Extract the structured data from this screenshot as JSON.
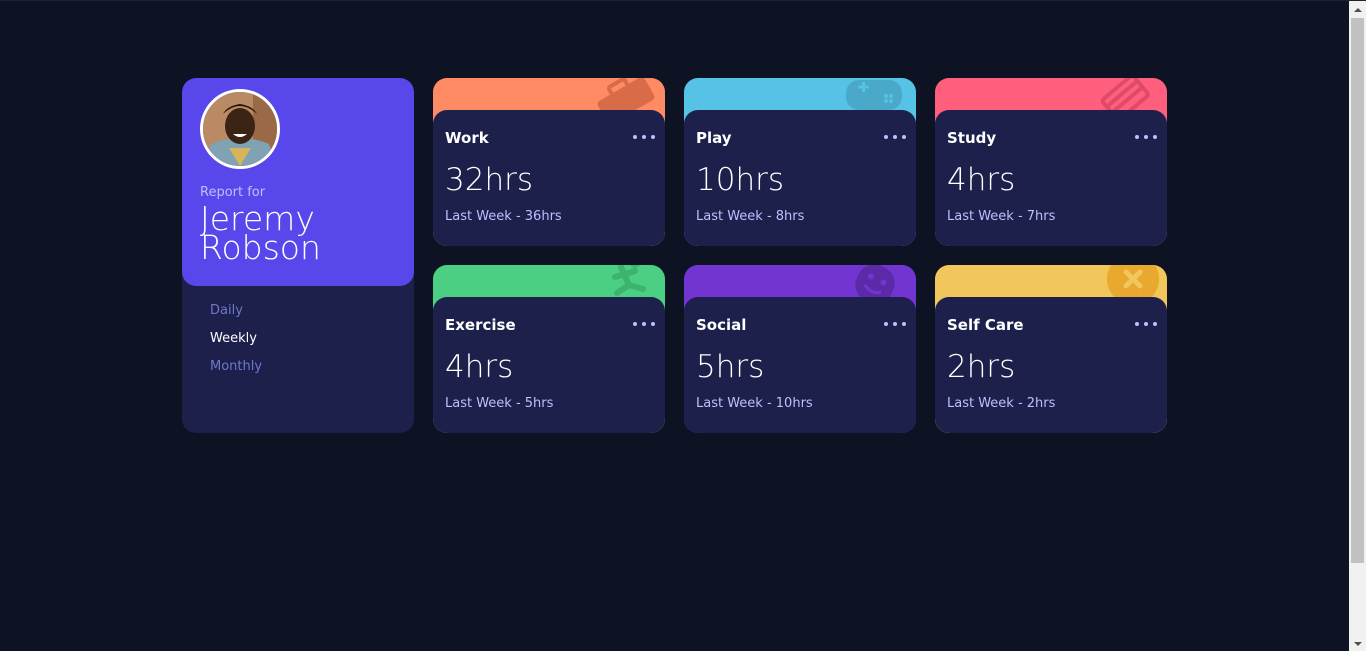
{
  "profile": {
    "report_for": "Report for",
    "name": "Jeremy Robson",
    "periods": [
      "Daily",
      "Weekly",
      "Monthly"
    ],
    "active_period": "Weekly"
  },
  "cards": [
    {
      "title": "Work",
      "current": "32hrs",
      "previous": "Last Week - 36hrs",
      "color": "#ff8b64",
      "icon": "briefcase-icon"
    },
    {
      "title": "Play",
      "current": "10hrs",
      "previous": "Last Week - 8hrs",
      "color": "#55c2e6",
      "icon": "gamepad-icon"
    },
    {
      "title": "Study",
      "current": "4hrs",
      "previous": "Last Week - 7hrs",
      "color": "#ff5e7d",
      "icon": "book-icon"
    },
    {
      "title": "Exercise",
      "current": "4hrs",
      "previous": "Last Week - 5hrs",
      "color": "#4bcf82",
      "icon": "running-icon"
    },
    {
      "title": "Social",
      "current": "5hrs",
      "previous": "Last Week - 10hrs",
      "color": "#7335d2",
      "icon": "social-icon"
    },
    {
      "title": "Self Care",
      "current": "2hrs",
      "previous": "Last Week - 2hrs",
      "color": "#f1c75b",
      "icon": "self-care-icon"
    }
  ],
  "colors": {
    "background": "#0e1323",
    "card": "#1c204b",
    "profile_accent": "#5847eb",
    "muted_text": "#bbc0ff",
    "period_text": "#7078c9"
  }
}
